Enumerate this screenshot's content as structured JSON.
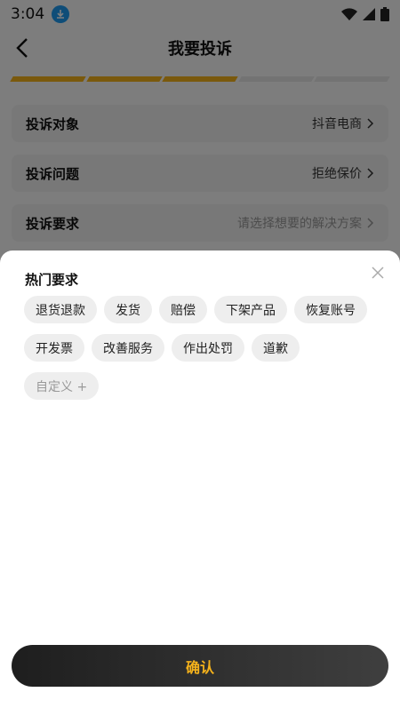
{
  "status_bar": {
    "time": "3:04"
  },
  "header": {
    "title": "我要投诉"
  },
  "progress": {
    "total_steps": 5,
    "completed_steps": 3
  },
  "form": {
    "rows": [
      {
        "label": "投诉对象",
        "value": "抖音电商"
      },
      {
        "label": "投诉问题",
        "value": "拒绝保价"
      },
      {
        "label": "投诉要求",
        "value": "请选择想要的解决方案"
      }
    ]
  },
  "sheet": {
    "title": "热门要求",
    "chips": [
      "退货退款",
      "发货",
      "赔偿",
      "下架产品",
      "恢复账号",
      "开发票",
      "改善服务",
      "作出处罚",
      "道歉",
      "自定义 +"
    ],
    "confirm_label": "确认"
  },
  "colors": {
    "accent": "#f5b21b",
    "button_dark": "#1e1e1e"
  }
}
